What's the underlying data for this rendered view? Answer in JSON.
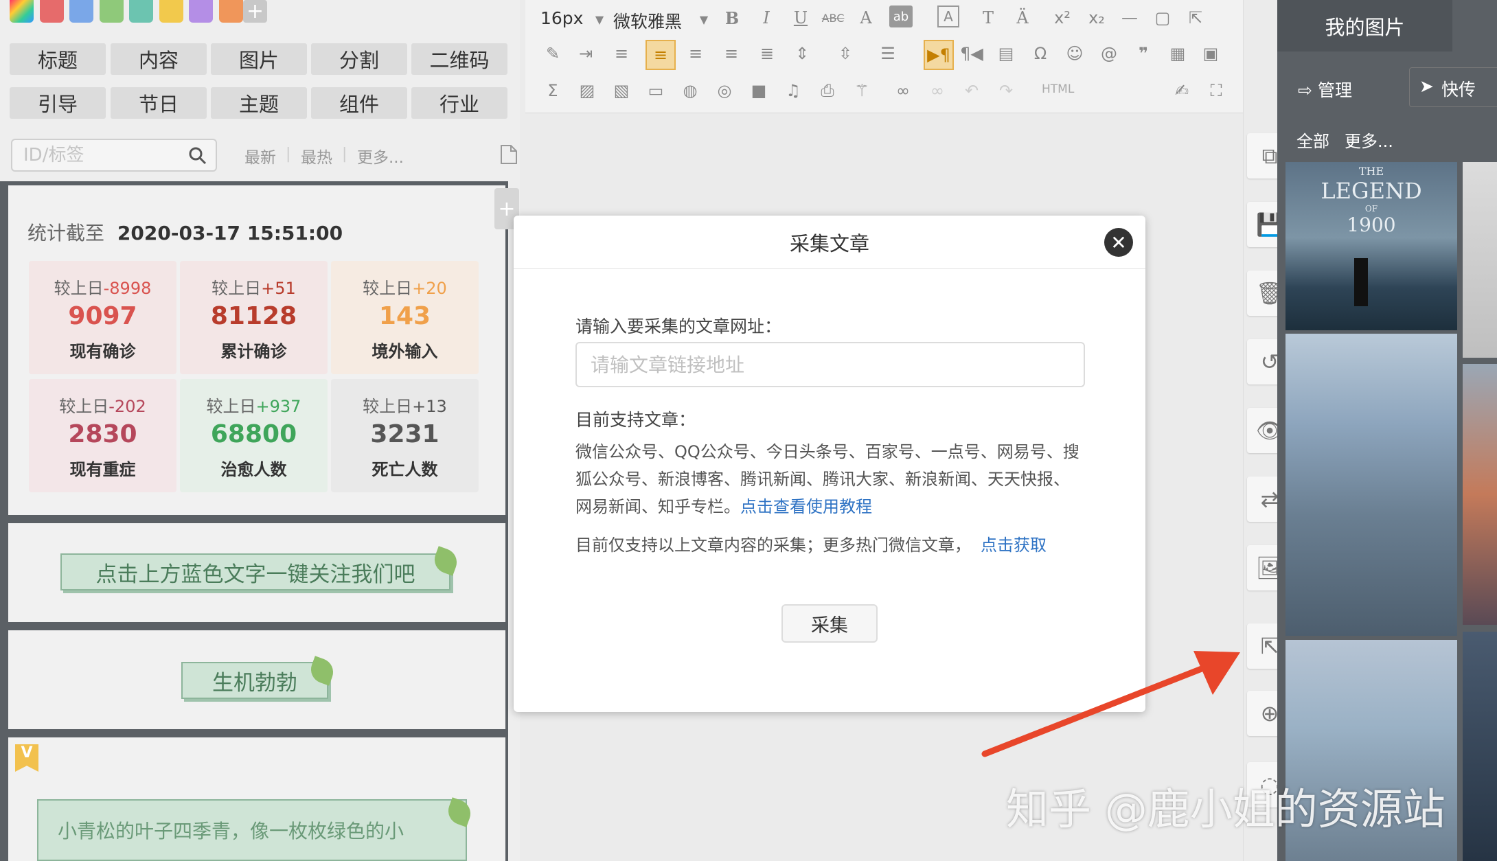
{
  "palette": [
    "#e66b6b",
    "#7aa7e8",
    "#8fc97a",
    "#6cc4b0",
    "#f2c94c",
    "#b48ee6",
    "#f0965a"
  ],
  "categories_row1": [
    "标题",
    "内容",
    "图片",
    "分割",
    "二维码"
  ],
  "categories_row2": [
    "引导",
    "节日",
    "主题",
    "组件",
    "行业"
  ],
  "search": {
    "placeholder": "ID/标签"
  },
  "filters": [
    "最新",
    "最热",
    "更多..."
  ],
  "stats": {
    "heading_prefix": "统计截至",
    "heading_date": "2020-03-17 15:51:00",
    "cells": [
      {
        "delta_label": "较上日",
        "delta": "-8998",
        "value": "9097",
        "label": "现有确诊",
        "color": "#d9534f",
        "bg": "#f3e6e6"
      },
      {
        "delta_label": "较上日",
        "delta": "+51",
        "value": "81128",
        "label": "累计确诊",
        "color": "#b83c2c",
        "bg": "#f3e6e6"
      },
      {
        "delta_label": "较上日",
        "delta": "+20",
        "value": "143",
        "label": "境外输入",
        "color": "#f0a04a",
        "bg": "#f6ebe2"
      },
      {
        "delta_label": "较上日",
        "delta": "-202",
        "value": "2830",
        "label": "现有重症",
        "color": "#b5475b",
        "bg": "#f3e6e8"
      },
      {
        "delta_label": "较上日",
        "delta": "+937",
        "value": "68800",
        "label": "治愈人数",
        "color": "#3fa55a",
        "bg": "#e6efe8"
      },
      {
        "delta_label": "较上日",
        "delta": "+13",
        "value": "3231",
        "label": "死亡人数",
        "color": "#555555",
        "bg": "#e9e9e9"
      }
    ]
  },
  "banners": {
    "follow": "点击上方蓝色文字一键关注我们吧",
    "vitality": "生机勃勃",
    "pine": "小青松的叶子四季青，像一枚枚绿色的小"
  },
  "toolbar": {
    "font_size": "16px",
    "font_family": "微软雅黑",
    "html": "HTML"
  },
  "right_panel": {
    "title": "我的图片",
    "manage": "管理",
    "quick": "快传",
    "all": "全部",
    "more": "更多..."
  },
  "modal": {
    "title": "采集文章",
    "prompt": "请输入要采集的文章网址：",
    "placeholder": "请输文章链接地址",
    "supported_title": "目前支持文章：",
    "supported_line1": "微信公众号、QQ公众号、今日头条号、百家号、一点号、网易号、搜",
    "supported_line2": "狐公众号、新浪博客、腾讯新闻、腾讯大家、新浪新闻、天天快报、",
    "supported_line3": "网易新闻、知乎专栏。",
    "tutorial_link": "点击查看使用教程",
    "note": "目前仅支持以上文章内容的采集；更多热门微信文章，",
    "get_link": "点击获取",
    "submit": "采集"
  },
  "poster": {
    "line1": "THE",
    "line2": "LEGEND",
    "line3": "OF",
    "line4": "1900"
  },
  "watermark": "知乎 @鹿小姐的资源站"
}
